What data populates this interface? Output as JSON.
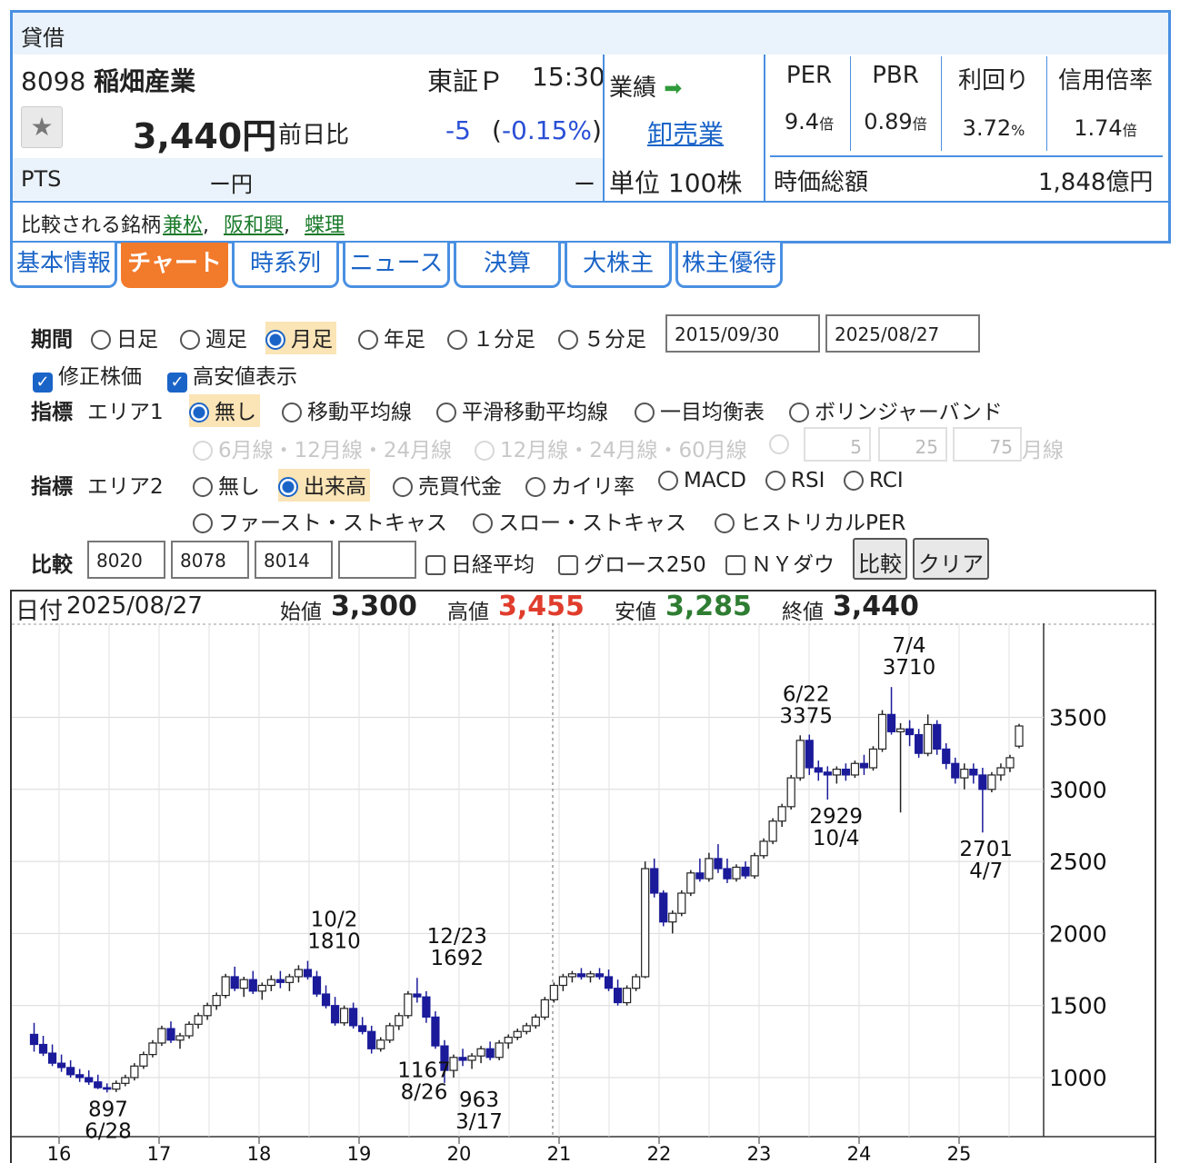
{
  "header": {
    "tag": "貸借",
    "code": "8098",
    "name": "稲畑産業",
    "market": "東証Ｐ",
    "time": "15:30",
    "price": "3,440円",
    "change_label": "前日比",
    "change": "-5",
    "change_pct_open": "(",
    "change_pct": "-0.15%",
    "change_pct_close": ")",
    "pts_label": "PTS",
    "pts_value": "ー円",
    "pts_change": "ー",
    "compare_label": "比較される銘柄",
    "compare": [
      "兼松",
      "阪和興",
      "蝶理"
    ],
    "gyoseki": "業績",
    "sector": "卸売業",
    "unit": "単位 100株",
    "metrics": [
      {
        "label": "PER",
        "value": "9.4",
        "unit": "倍"
      },
      {
        "label": "PBR",
        "value": "0.89",
        "unit": "倍"
      },
      {
        "label": "利回り",
        "value": "3.72",
        "unit": "%"
      },
      {
        "label": "信用倍率",
        "value": "1.74",
        "unit": "倍"
      }
    ],
    "market_cap_label": "時価総額",
    "market_cap": "1,848億円"
  },
  "tabs": [
    "基本情報",
    "チャート",
    "時系列",
    "ニュース",
    "決算",
    "大株主",
    "株主優待"
  ],
  "active_tab": "チャート",
  "controls": {
    "period_label": "期間",
    "period_options": [
      "日足",
      "週足",
      "月足",
      "年足",
      "１分足",
      "５分足"
    ],
    "period_selected": "月足",
    "date_from": "2015/09/30",
    "date_to": "2025/08/27",
    "adjusted": "修正株価",
    "highlow": "高安値表示",
    "ind_label": "指標",
    "area1": "エリア1",
    "area1_options": [
      "無し",
      "移動平均線",
      "平滑移動平均線",
      "一目均衡表",
      "ボリンジャーバンド"
    ],
    "area1_sub": [
      "6月線・12月線・24月線",
      "12月線・24月線・60月線"
    ],
    "ma_inputs": [
      "5",
      "25",
      "75"
    ],
    "ma_unit": "月線",
    "area2": "エリア2",
    "area2_options": [
      "無し",
      "出来高",
      "売買代金",
      "カイリ率",
      "MACD",
      "RSI",
      "RCI"
    ],
    "area2_options2": [
      "ファースト・ストキャス",
      "スロー・ストキャス",
      "ヒストリカルPER"
    ],
    "compare_label": "比較",
    "compare_codes": [
      "8020",
      "8078",
      "8014",
      ""
    ],
    "compare_indices": [
      "日経平均",
      "グロース250",
      "ＮＹダウ"
    ],
    "btn_compare": "比較",
    "btn_clear": "クリア"
  },
  "ohlc_info": {
    "date_label": "日付",
    "date": "2025/08/27",
    "open_label": "始値",
    "open": "3,300",
    "high_label": "高値",
    "high": "3,455",
    "low_label": "安値",
    "low": "3,285",
    "close_label": "終値",
    "close": "3,440"
  },
  "colors": {
    "accent": "#4a90e2",
    "active_tab": "#f27a2b",
    "up": "#ffffff",
    "down": "#1a1a9a",
    "high": "#e03c2c",
    "low": "#2e7d32",
    "link": "#1a64c8"
  },
  "chart_data": {
    "type": "candlestick",
    "x_ticks": [
      "16",
      "17",
      "18",
      "19",
      "20",
      "21",
      "22",
      "23",
      "24",
      "25"
    ],
    "y_ticks": [
      1000,
      1500,
      2000,
      2500,
      3000,
      3500
    ],
    "ylim": [
      700,
      4000
    ],
    "x_start": 2015.75,
    "annotations": [
      {
        "text1": "897",
        "text2": "6/28",
        "x": 2016.49,
        "y": 897,
        "pos": "below"
      },
      {
        "text1": "10/2",
        "text2": "1810",
        "x": 2018.75,
        "y": 1810,
        "pos": "above"
      },
      {
        "text1": "1167",
        "text2": "8/26",
        "x": 2019.65,
        "y": 1167,
        "pos": "below"
      },
      {
        "text1": "12/23",
        "text2": "1692",
        "x": 2019.98,
        "y": 1692,
        "pos": "above"
      },
      {
        "text1": "963",
        "text2": "3/17",
        "x": 2020.2,
        "y": 963,
        "pos": "below"
      },
      {
        "text1": "6/22",
        "text2": "3375",
        "x": 2023.47,
        "y": 3375,
        "pos": "above"
      },
      {
        "text1": "2929",
        "text2": "10/4",
        "x": 2023.77,
        "y": 2929,
        "pos": "below"
      },
      {
        "text1": "7/4",
        "text2": "3710",
        "x": 2024.5,
        "y": 3710,
        "pos": "above"
      },
      {
        "text1": "2701",
        "text2": "4/7",
        "x": 2025.27,
        "y": 2701,
        "pos": "below"
      }
    ],
    "candles": [
      [
        1300,
        1380,
        1180,
        1230
      ],
      [
        1230,
        1290,
        1150,
        1170
      ],
      [
        1170,
        1230,
        1080,
        1100
      ],
      [
        1100,
        1160,
        1040,
        1070
      ],
      [
        1070,
        1120,
        1000,
        1020
      ],
      [
        1020,
        1060,
        970,
        1000
      ],
      [
        1000,
        1050,
        950,
        970
      ],
      [
        970,
        1020,
        920,
        930
      ],
      [
        930,
        960,
        897,
        920
      ],
      [
        920,
        980,
        900,
        960
      ],
      [
        960,
        1020,
        940,
        1000
      ],
      [
        1000,
        1100,
        980,
        1080
      ],
      [
        1080,
        1180,
        1060,
        1160
      ],
      [
        1160,
        1260,
        1140,
        1240
      ],
      [
        1240,
        1360,
        1220,
        1340
      ],
      [
        1340,
        1390,
        1240,
        1260
      ],
      [
        1260,
        1310,
        1200,
        1290
      ],
      [
        1290,
        1390,
        1270,
        1370
      ],
      [
        1370,
        1450,
        1340,
        1430
      ],
      [
        1430,
        1520,
        1400,
        1500
      ],
      [
        1500,
        1590,
        1470,
        1570
      ],
      [
        1570,
        1720,
        1550,
        1700
      ],
      [
        1700,
        1770,
        1600,
        1620
      ],
      [
        1620,
        1700,
        1560,
        1680
      ],
      [
        1680,
        1740,
        1580,
        1600
      ],
      [
        1600,
        1660,
        1540,
        1640
      ],
      [
        1640,
        1710,
        1600,
        1680
      ],
      [
        1680,
        1740,
        1620,
        1660
      ],
      [
        1660,
        1720,
        1600,
        1700
      ],
      [
        1700,
        1780,
        1660,
        1750
      ],
      [
        1750,
        1810,
        1680,
        1700
      ],
      [
        1700,
        1740,
        1560,
        1580
      ],
      [
        1580,
        1640,
        1480,
        1500
      ],
      [
        1500,
        1560,
        1360,
        1380
      ],
      [
        1380,
        1500,
        1360,
        1480
      ],
      [
        1480,
        1520,
        1340,
        1360
      ],
      [
        1360,
        1420,
        1300,
        1320
      ],
      [
        1320,
        1360,
        1167,
        1200
      ],
      [
        1200,
        1280,
        1180,
        1260
      ],
      [
        1260,
        1380,
        1240,
        1360
      ],
      [
        1360,
        1450,
        1330,
        1430
      ],
      [
        1430,
        1600,
        1410,
        1580
      ],
      [
        1580,
        1692,
        1520,
        1560
      ],
      [
        1560,
        1600,
        1380,
        1420
      ],
      [
        1420,
        1460,
        1200,
        1220
      ],
      [
        1220,
        1260,
        963,
        1050
      ],
      [
        1050,
        1160,
        1000,
        1140
      ],
      [
        1140,
        1200,
        1080,
        1120
      ],
      [
        1120,
        1170,
        1060,
        1150
      ],
      [
        1150,
        1220,
        1100,
        1200
      ],
      [
        1200,
        1250,
        1120,
        1140
      ],
      [
        1140,
        1260,
        1120,
        1240
      ],
      [
        1240,
        1300,
        1200,
        1280
      ],
      [
        1280,
        1340,
        1260,
        1320
      ],
      [
        1320,
        1380,
        1300,
        1360
      ],
      [
        1360,
        1440,
        1340,
        1420
      ],
      [
        1420,
        1560,
        1400,
        1540
      ],
      [
        1540,
        1660,
        1520,
        1640
      ],
      [
        1640,
        1720,
        1600,
        1700
      ],
      [
        1700,
        1740,
        1660,
        1720
      ],
      [
        1720,
        1760,
        1680,
        1700
      ],
      [
        1700,
        1740,
        1660,
        1720
      ],
      [
        1720,
        1760,
        1680,
        1700
      ],
      [
        1700,
        1750,
        1600,
        1620
      ],
      [
        1620,
        1680,
        1500,
        1520
      ],
      [
        1520,
        1640,
        1500,
        1620
      ],
      [
        1620,
        1720,
        1600,
        1700
      ],
      [
        1700,
        2500,
        1690,
        2450
      ],
      [
        2450,
        2520,
        2250,
        2280
      ],
      [
        2280,
        2300,
        2050,
        2080
      ],
      [
        2080,
        2160,
        2000,
        2140
      ],
      [
        2140,
        2300,
        2120,
        2280
      ],
      [
        2280,
        2440,
        2260,
        2420
      ],
      [
        2420,
        2520,
        2360,
        2380
      ],
      [
        2380,
        2560,
        2360,
        2520
      ],
      [
        2520,
        2620,
        2420,
        2450
      ],
      [
        2450,
        2520,
        2350,
        2380
      ],
      [
        2380,
        2480,
        2360,
        2460
      ],
      [
        2460,
        2500,
        2380,
        2400
      ],
      [
        2400,
        2560,
        2380,
        2540
      ],
      [
        2540,
        2660,
        2520,
        2640
      ],
      [
        2640,
        2800,
        2620,
        2780
      ],
      [
        2780,
        2900,
        2740,
        2880
      ],
      [
        2880,
        3100,
        2860,
        3080
      ],
      [
        3080,
        3375,
        3060,
        3340
      ],
      [
        3340,
        3380,
        3100,
        3150
      ],
      [
        3150,
        3200,
        3060,
        3120
      ],
      [
        3120,
        3160,
        2929,
        3100
      ],
      [
        3100,
        3160,
        3040,
        3140
      ],
      [
        3140,
        3180,
        3060,
        3100
      ],
      [
        3100,
        3200,
        3080,
        3180
      ],
      [
        3180,
        3240,
        3100,
        3150
      ],
      [
        3150,
        3300,
        3130,
        3280
      ],
      [
        3280,
        3550,
        3260,
        3520
      ],
      [
        3520,
        3710,
        3380,
        3400
      ],
      [
        3400,
        3460,
        2840,
        3420
      ],
      [
        3420,
        3480,
        3300,
        3380
      ],
      [
        3380,
        3420,
        3220,
        3250
      ],
      [
        3250,
        3520,
        3230,
        3450
      ],
      [
        3450,
        3480,
        3240,
        3280
      ],
      [
        3280,
        3320,
        3140,
        3180
      ],
      [
        3180,
        3220,
        3040,
        3080
      ],
      [
        3080,
        3180,
        3000,
        3140
      ],
      [
        3140,
        3180,
        3040,
        3100
      ],
      [
        3100,
        3150,
        2701,
        3000
      ],
      [
        3000,
        3120,
        2980,
        3100
      ],
      [
        3100,
        3180,
        3060,
        3150
      ],
      [
        3150,
        3240,
        3120,
        3220
      ],
      [
        3300,
        3455,
        3285,
        3440
      ]
    ]
  }
}
